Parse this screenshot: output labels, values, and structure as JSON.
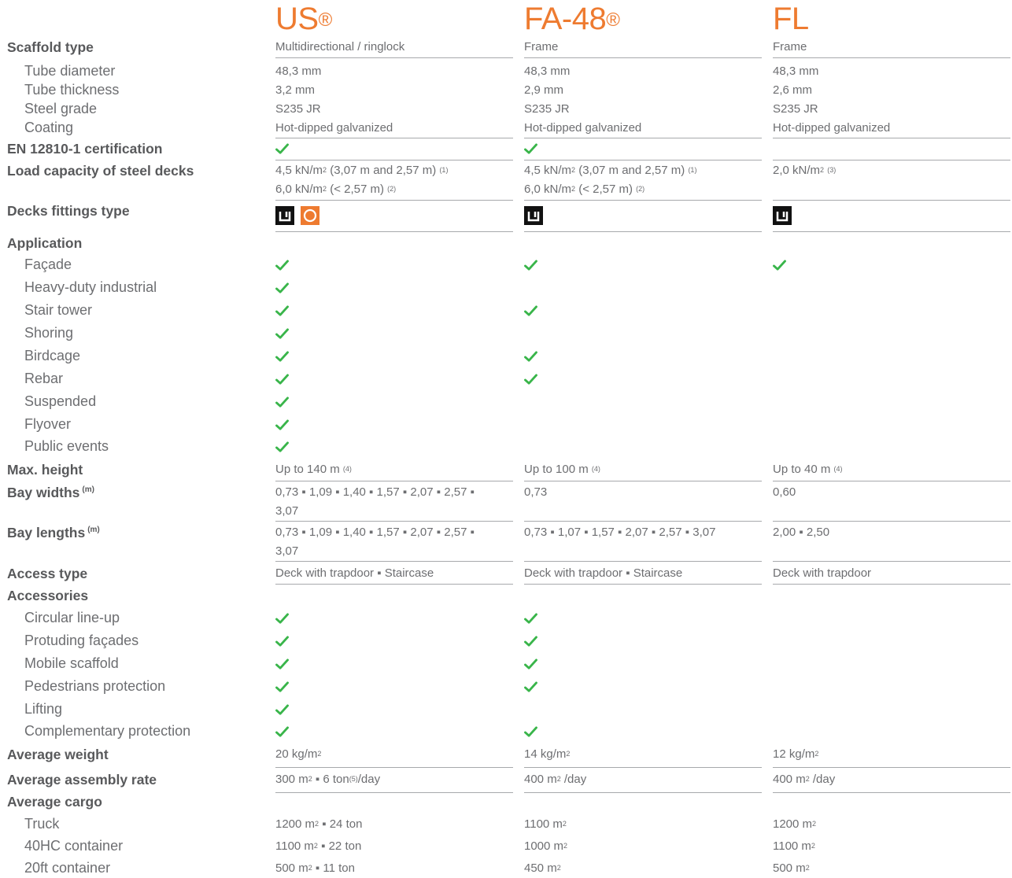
{
  "columns": [
    {
      "name": "US",
      "mark": "®"
    },
    {
      "name": "FA-48",
      "mark": "®"
    },
    {
      "name": "FL",
      "mark": ""
    }
  ],
  "rows": [
    {
      "label": "Scaffold type",
      "type": "main",
      "values": [
        "Multidirectional / ringlock",
        "Frame",
        "Frame"
      ]
    },
    {
      "label": "Tube diameter",
      "type": "sub",
      "values": [
        "48,3 mm",
        "48,3 mm",
        "48,3 mm"
      ]
    },
    {
      "label": "Tube thickness",
      "type": "sub",
      "values": [
        "3,2 mm",
        "2,9 mm",
        "2,6 mm"
      ]
    },
    {
      "label": "Steel grade",
      "type": "sub",
      "values": [
        "S235 JR",
        "S235 JR",
        "S235 JR"
      ]
    },
    {
      "label": "Coating",
      "type": "sub",
      "values": [
        "Hot-dipped galvanized",
        "Hot-dipped galvanized",
        "Hot-dipped galvanized"
      ]
    },
    {
      "label": "EN 12810-1 certification",
      "type": "main",
      "checks": [
        true,
        true,
        false
      ]
    },
    {
      "label": "Load capacity of steel decks",
      "type": "main",
      "values": [
        "4,5 kN/m² (3,07 m and 2,57 m) ⁽¹⁾ | 6,0 kN/m² (< 2,57 m) ⁽²⁾",
        "4,5 kN/m² (3,07 m and 2,57 m) ⁽¹⁾ | 6,0 kN/m² (< 2,57 m) ⁽²⁾",
        "2,0 kN/m² ⁽³⁾"
      ]
    },
    {
      "label": "Decks fittings type",
      "type": "main",
      "icons": [
        [
          "hook-icon",
          "round-icon"
        ],
        [
          "hook-icon"
        ],
        [
          "hook-icon"
        ]
      ]
    },
    {
      "label": "Application",
      "type": "main"
    },
    {
      "label": "Façade",
      "type": "sub",
      "checks": [
        true,
        true,
        true
      ]
    },
    {
      "label": "Heavy-duty industrial",
      "type": "sub",
      "checks": [
        true,
        false,
        false
      ]
    },
    {
      "label": "Stair tower",
      "type": "sub",
      "checks": [
        true,
        true,
        false
      ]
    },
    {
      "label": "Shoring",
      "type": "sub",
      "checks": [
        true,
        false,
        false
      ]
    },
    {
      "label": "Birdcage",
      "type": "sub",
      "checks": [
        true,
        true,
        false
      ]
    },
    {
      "label": "Rebar",
      "type": "sub",
      "checks": [
        true,
        true,
        false
      ]
    },
    {
      "label": "Suspended",
      "type": "sub",
      "checks": [
        true,
        false,
        false
      ]
    },
    {
      "label": "Flyover",
      "type": "sub",
      "checks": [
        true,
        false,
        false
      ]
    },
    {
      "label": "Public events",
      "type": "sub",
      "checks": [
        true,
        false,
        false
      ]
    },
    {
      "label": "Max. height",
      "type": "main",
      "values": [
        "Up to 140 m ⁽⁴⁾",
        "Up to 100 m ⁽⁴⁾",
        "Up to 40 m ⁽⁴⁾"
      ]
    },
    {
      "label": "Bay widths",
      "label_sup": "(m)",
      "type": "main",
      "values": [
        "0,73 ▪ 1,09 ▪ 1,40 ▪ 1,57 ▪ 2,07 ▪ 2,57 ▪ | 3,07",
        "0,73",
        "0,60"
      ]
    },
    {
      "label": "Bay lengths",
      "label_sup": "(m)",
      "type": "main",
      "values": [
        "0,73 ▪ 1,09 ▪ 1,40 ▪ 1,57 ▪ 2,07 ▪ 2,57 ▪ | 3,07",
        "0,73 ▪ 1,07 ▪ 1,57 ▪ 2,07 ▪ 2,57 ▪ 3,07",
        "2,00 ▪ 2,50"
      ]
    },
    {
      "label": "Access type",
      "type": "main",
      "values": [
        "Deck with trapdoor ▪ Staircase",
        "Deck with trapdoor ▪ Staircase",
        "Deck with trapdoor"
      ]
    },
    {
      "label": "Accessories",
      "type": "main"
    },
    {
      "label": "Circular line-up",
      "type": "sub",
      "checks": [
        true,
        true,
        false
      ]
    },
    {
      "label": "Protuding façades",
      "type": "sub",
      "checks": [
        true,
        true,
        false
      ]
    },
    {
      "label": "Mobile scaffold",
      "type": "sub",
      "checks": [
        true,
        true,
        false
      ]
    },
    {
      "label": "Pedestrians protection",
      "type": "sub",
      "checks": [
        true,
        true,
        false
      ]
    },
    {
      "label": "Lifting",
      "type": "sub",
      "checks": [
        true,
        false,
        false
      ]
    },
    {
      "label": "Complementary protection",
      "type": "sub",
      "checks": [
        true,
        true,
        false
      ]
    },
    {
      "label": "Average weight",
      "type": "main",
      "values": [
        "20 kg/m²",
        "14 kg/m²",
        "12 kg/m²"
      ]
    },
    {
      "label": "Average assembly rate",
      "type": "main",
      "values": [
        "300 m² ▪ 6 ton⁽⁵⁾/day",
        "400 m² /day",
        "400 m² /day"
      ]
    },
    {
      "label": "Average cargo",
      "type": "main"
    },
    {
      "label": "Truck",
      "type": "sub",
      "values": [
        "1200 m² ▪ 24 ton",
        "1100 m²",
        "1200 m²"
      ]
    },
    {
      "label": "40HC container",
      "type": "sub",
      "values": [
        "1100 m² ▪ 22 ton",
        "1000 m²",
        "1100 m²"
      ]
    },
    {
      "label": "20ft container",
      "type": "sub",
      "values": [
        "500 m² ▪ 11 ton",
        "450 m²",
        "500 m²"
      ]
    }
  ],
  "colors": {
    "accent": "#ee7b30",
    "check": "#39b54a",
    "text": "#6d6e71",
    "line": "#a7a9ac"
  }
}
